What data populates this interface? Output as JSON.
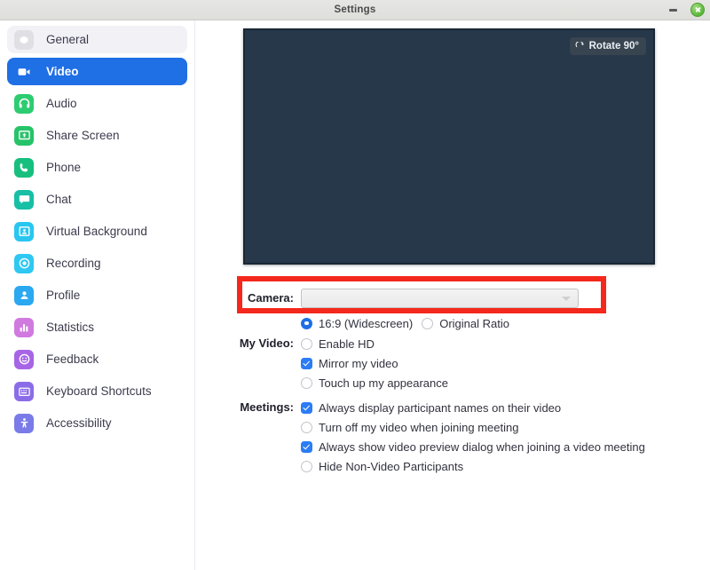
{
  "window": {
    "title": "Settings",
    "minimize_label": "Minimize",
    "close_label": "Close"
  },
  "sidebar": {
    "items": [
      {
        "label": "General",
        "icon": "gear-icon",
        "state": "hovered"
      },
      {
        "label": "Video",
        "icon": "video-camera-icon",
        "state": "active"
      },
      {
        "label": "Audio",
        "icon": "headphones-icon",
        "state": "normal"
      },
      {
        "label": "Share Screen",
        "icon": "share-screen-icon",
        "state": "normal"
      },
      {
        "label": "Phone",
        "icon": "phone-icon",
        "state": "normal"
      },
      {
        "label": "Chat",
        "icon": "chat-bubble-icon",
        "state": "normal"
      },
      {
        "label": "Virtual Background",
        "icon": "virtual-background-icon",
        "state": "normal"
      },
      {
        "label": "Recording",
        "icon": "record-icon",
        "state": "normal"
      },
      {
        "label": "Profile",
        "icon": "person-icon",
        "state": "normal"
      },
      {
        "label": "Statistics",
        "icon": "bar-chart-icon",
        "state": "normal"
      },
      {
        "label": "Feedback",
        "icon": "smiley-icon",
        "state": "normal"
      },
      {
        "label": "Keyboard Shortcuts",
        "icon": "keyboard-icon",
        "state": "normal"
      },
      {
        "label": "Accessibility",
        "icon": "accessibility-icon",
        "state": "normal"
      }
    ]
  },
  "video_panel": {
    "preview_label": "Camera preview",
    "rotate_button": "Rotate 90°",
    "camera": {
      "label": "Camera:",
      "selected_value": "",
      "placeholder": ""
    },
    "aspect_ratio": {
      "options": [
        {
          "label": "16:9 (Widescreen)",
          "selected": true
        },
        {
          "label": "Original Ratio",
          "selected": false
        }
      ]
    },
    "my_video": {
      "label": "My Video:",
      "options": [
        {
          "label": "Enable HD",
          "checked": false
        },
        {
          "label": "Mirror my video",
          "checked": true
        },
        {
          "label": "Touch up my appearance",
          "checked": false
        }
      ]
    },
    "meetings": {
      "label": "Meetings:",
      "options": [
        {
          "label": "Always display participant names on their video",
          "checked": true
        },
        {
          "label": "Turn off my video when joining meeting",
          "checked": false
        },
        {
          "label": "Always show video preview dialog when joining a video meeting",
          "checked": true
        },
        {
          "label": "Hide Non-Video Participants",
          "checked": false
        }
      ]
    }
  },
  "annotation": {
    "highlight_color": "#f4281c",
    "highlight_target": "camera-select"
  },
  "colors": {
    "accent_blue": "#1f6fe5",
    "checkbox_blue": "#2b7cf5",
    "preview_bg": "#26384a",
    "titlebar_bg": "#e2e2df"
  }
}
